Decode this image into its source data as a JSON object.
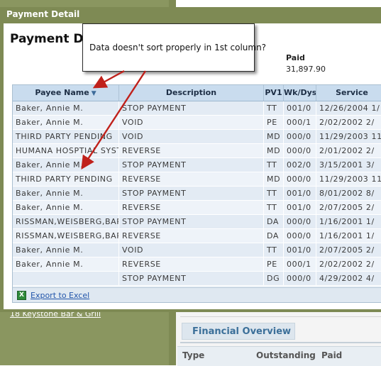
{
  "background": {
    "sidebar_link": "18 Keystone Bar & Grill",
    "financial_tab": "Financial Overview",
    "financial_columns": [
      "Type",
      "Outstanding",
      "Paid"
    ]
  },
  "popup": {
    "window_title": "Payment Detail",
    "page_title": "Payment Detail",
    "paid_label": "Paid",
    "paid_value": "31,897.90"
  },
  "grid": {
    "columns": [
      "Payee Name",
      "Description",
      "PV1",
      "Wk/Dys",
      "Service"
    ],
    "sort_icon": "sort-descending-icon",
    "rows": [
      [
        "Baker, Annie M.",
        "STOP PAYMENT",
        "TT",
        "001/0",
        "12/26/2004 1/"
      ],
      [
        "Baker, Annie M.",
        "VOID",
        "PE",
        "000/1",
        "2/02/2002 2/"
      ],
      [
        "THIRD PARTY PENDING",
        "VOID",
        "MD",
        "000/0",
        "11/29/2003 11"
      ],
      [
        "HUMANA HOSPTIAL SYSTEM",
        "REVERSE",
        "MD",
        "000/0",
        "2/01/2002 2/"
      ],
      [
        "Baker, Annie M.",
        "STOP PAYMENT",
        "TT",
        "002/0",
        "3/15/2001 3/"
      ],
      [
        "THIRD PARTY PENDING",
        "REVERSE",
        "MD",
        "000/0",
        "11/29/2003 11"
      ],
      [
        "Baker, Annie M.",
        "STOP PAYMENT",
        "TT",
        "001/0",
        "8/01/2002 8/"
      ],
      [
        "Baker, Annie M.",
        "REVERSE",
        "TT",
        "001/0",
        "2/07/2005 2/"
      ],
      [
        "RISSMAN,WEISBERG,BARRETT",
        "STOP PAYMENT",
        "DA",
        "000/0",
        "1/16/2001 1/"
      ],
      [
        "RISSMAN,WEISBERG,BARRETT",
        "REVERSE",
        "DA",
        "000/0",
        "1/16/2001 1/"
      ],
      [
        "Baker, Annie M.",
        "VOID",
        "TT",
        "001/0",
        "2/07/2005 2/"
      ],
      [
        "Baker, Annie M.",
        "REVERSE",
        "PE",
        "000/1",
        "2/02/2002 2/"
      ],
      [
        "",
        "STOP PAYMENT",
        "DG",
        "000/0",
        "4/29/2002 4/"
      ]
    ],
    "export_label": "Export to Excel"
  },
  "annotation": {
    "callout_text": "Data doesn't sort properly in 1st column?",
    "arrow_color": "#c0211b"
  }
}
